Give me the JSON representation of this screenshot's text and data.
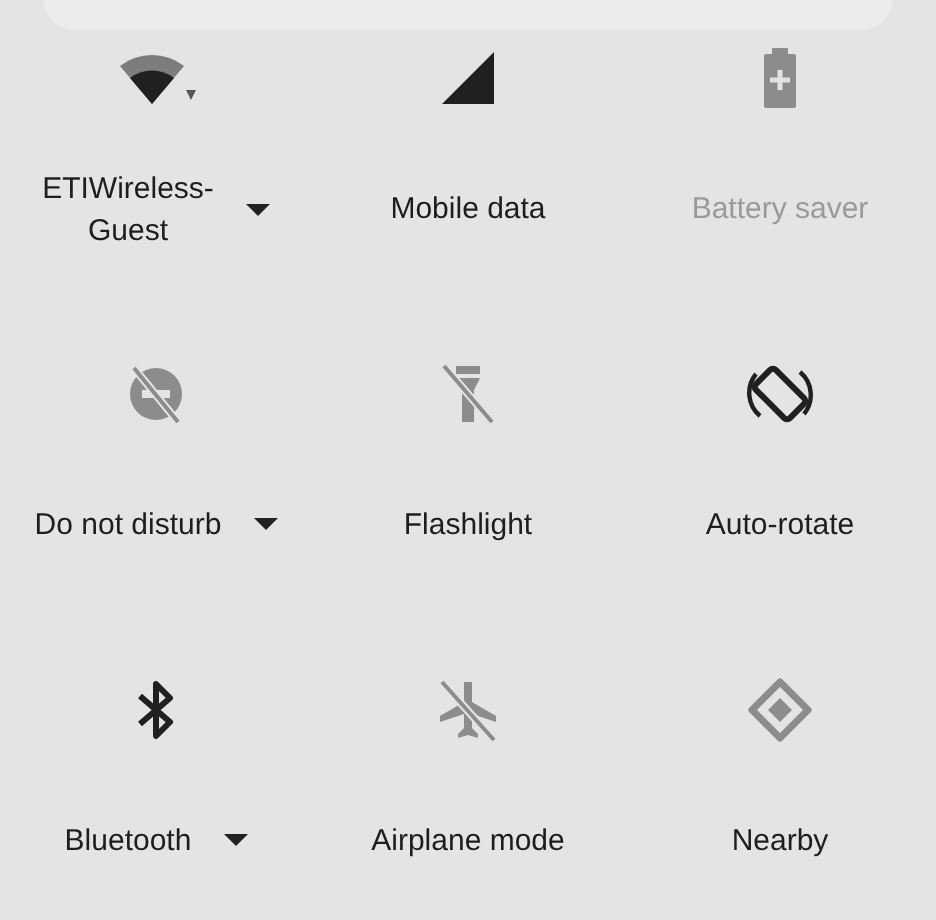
{
  "tiles": [
    {
      "kind": "wifi",
      "label": "ETIWireless-\nGuest",
      "on": true,
      "has_menu": true,
      "unavailable": false
    },
    {
      "kind": "cellular",
      "label": "Mobile data",
      "on": true,
      "has_menu": false,
      "unavailable": false
    },
    {
      "kind": "battery",
      "label": "Battery saver",
      "on": false,
      "has_menu": false,
      "unavailable": true
    },
    {
      "kind": "dnd",
      "label": "Do not disturb",
      "on": false,
      "has_menu": true,
      "unavailable": false
    },
    {
      "kind": "flashlight",
      "label": "Flashlight",
      "on": false,
      "has_menu": false,
      "unavailable": false
    },
    {
      "kind": "rotate",
      "label": "Auto-rotate",
      "on": true,
      "has_menu": false,
      "unavailable": false
    },
    {
      "kind": "bluetooth",
      "label": "Bluetooth",
      "on": true,
      "has_menu": true,
      "unavailable": false
    },
    {
      "kind": "airplane",
      "label": "Airplane mode",
      "on": false,
      "has_menu": false,
      "unavailable": false
    },
    {
      "kind": "nearby",
      "label": "Nearby",
      "on": false,
      "has_menu": false,
      "unavailable": false
    }
  ]
}
